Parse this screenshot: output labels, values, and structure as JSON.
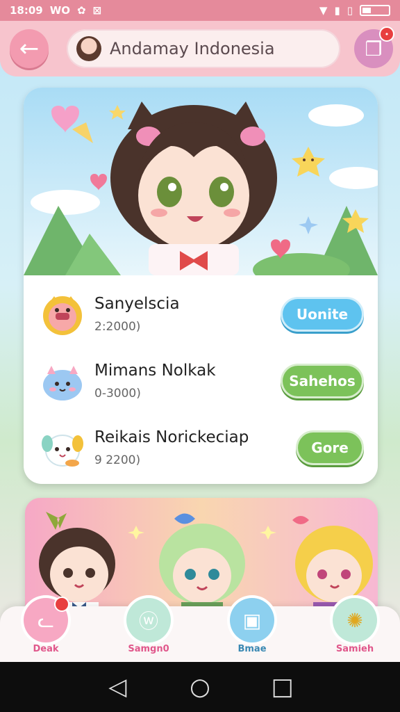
{
  "status_bar": {
    "time": "18:09",
    "carrier": "WO",
    "app_badge": "⊠"
  },
  "header": {
    "title": "Andamay Indonesia",
    "share_badge": "•"
  },
  "list": [
    {
      "title": "Sanyelscia",
      "subtitle": "2:2000)",
      "button": "Uonite",
      "button_color": "#5ec3ef"
    },
    {
      "title": "Mimans Nolkak",
      "subtitle": "0-3000)",
      "button": "Sahehos",
      "button_color": "#7cc25a"
    },
    {
      "title": "Reikais Norickeciap",
      "subtitle": "9 2200)",
      "button": "Gore",
      "button_color": "#7cc25a"
    }
  ],
  "bottom_nav": [
    {
      "label": "Deak",
      "icon": "cat-icon",
      "color": "#f7a8c3",
      "text_color": "#e0578b"
    },
    {
      "label": "Samgn0",
      "icon": "bunny-icon",
      "color": "#bfe8d8",
      "text_color": "#e0578b"
    },
    {
      "label": "Bmae",
      "icon": "board-icon",
      "color": "#8dd0ef",
      "text_color": "#3a89b3"
    },
    {
      "label": "Samieh",
      "icon": "gear-icon",
      "color": "#bfe8d8",
      "text_color": "#e0578b"
    }
  ]
}
